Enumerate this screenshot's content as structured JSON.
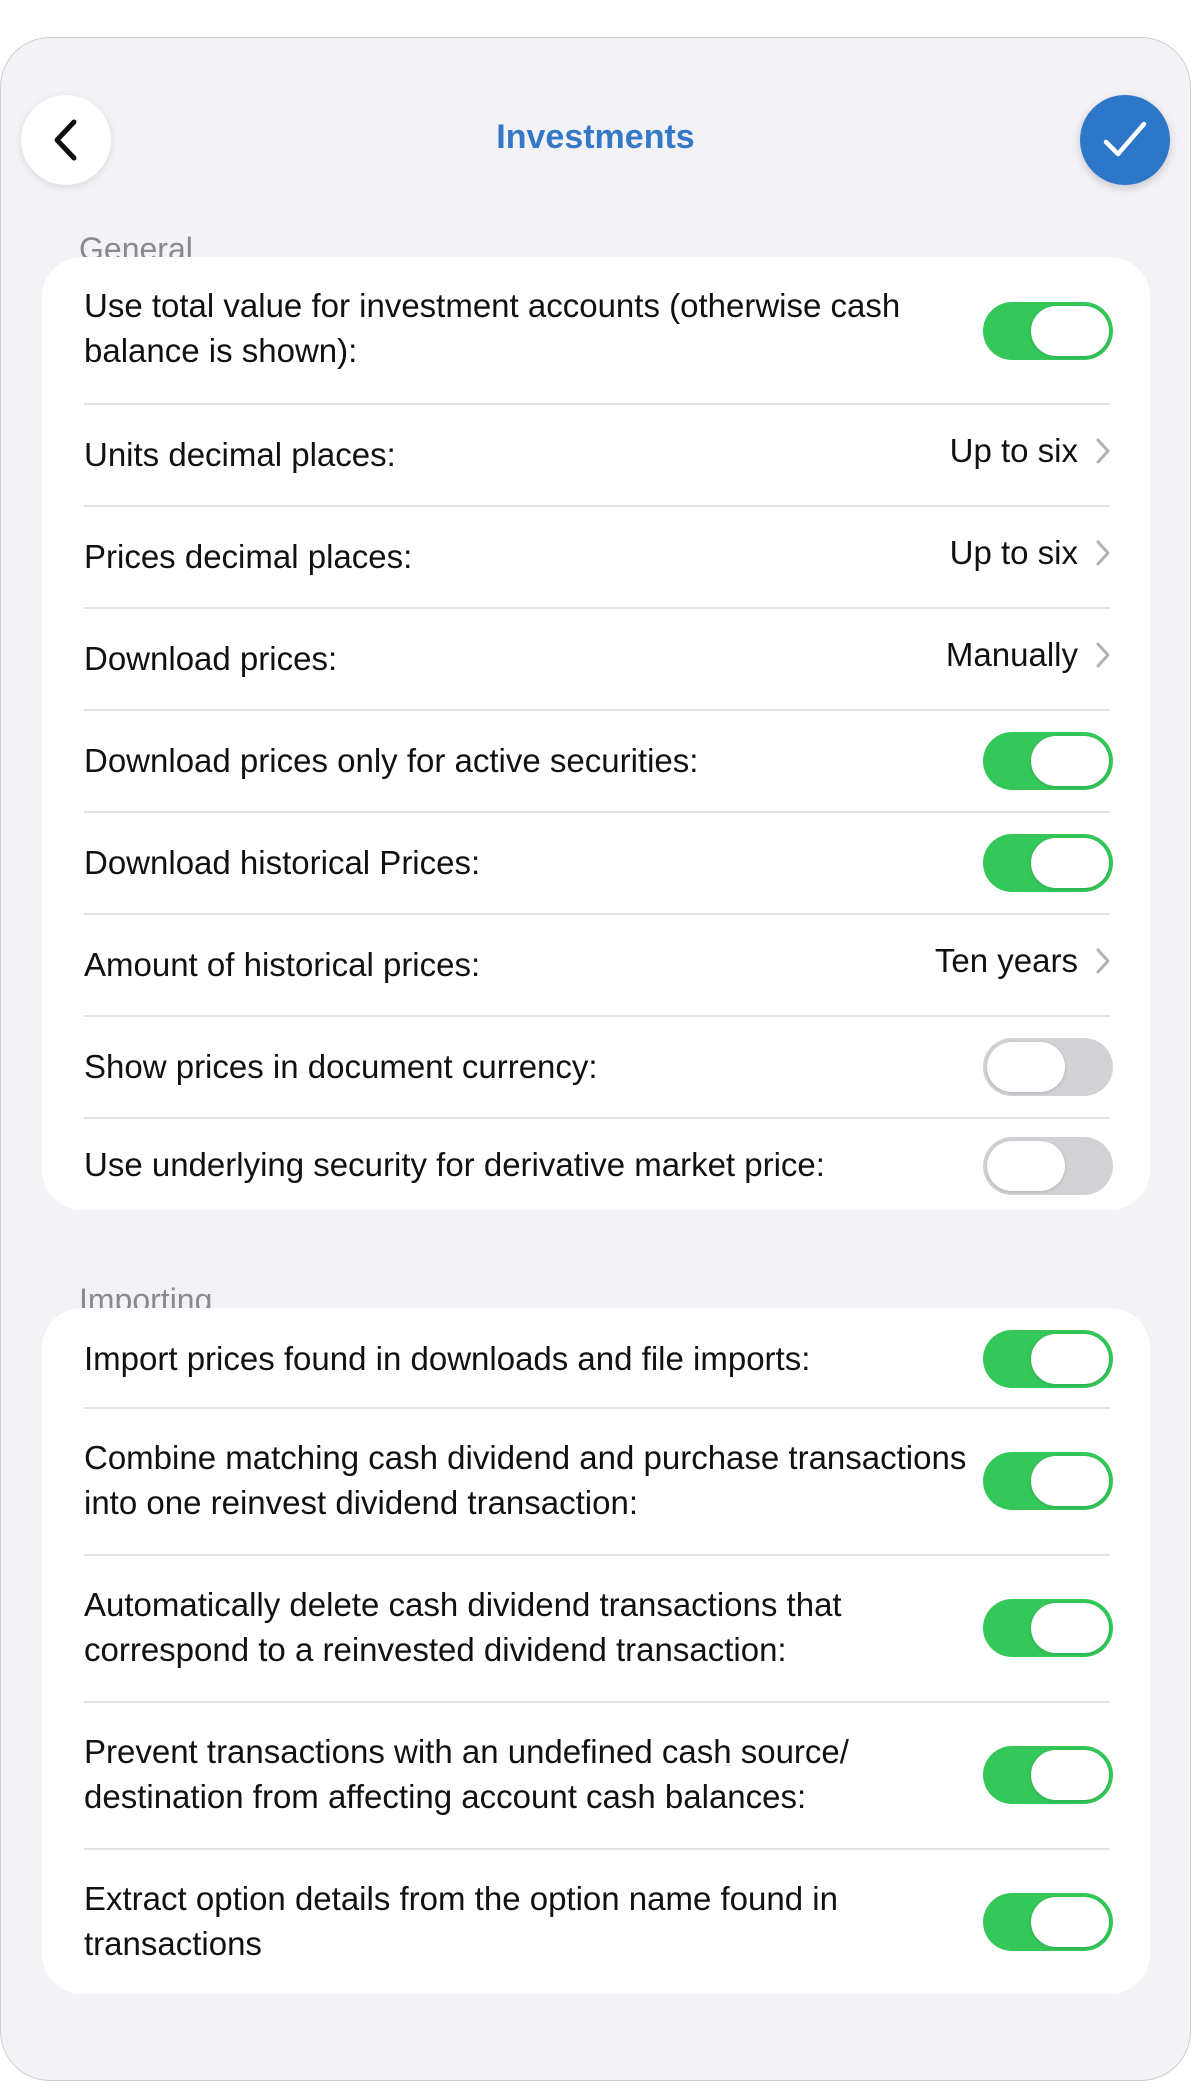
{
  "header": {
    "title": "Investments",
    "back_icon": "chevron-left-icon",
    "done_icon": "checkmark-icon",
    "accent_color": "#2d77c9"
  },
  "sections": {
    "general": {
      "title": "General",
      "rows": [
        {
          "label": "Use total value for investment accounts (otherwise cash balance is shown):",
          "type": "toggle",
          "on": true
        },
        {
          "label": "Units decimal places:",
          "type": "value",
          "value": "Up to six"
        },
        {
          "label": "Prices decimal places:",
          "type": "value",
          "value": "Up to six"
        },
        {
          "label": "Download prices:",
          "type": "value",
          "value": "Manually"
        },
        {
          "label": "Download prices only for active securities:",
          "type": "toggle",
          "on": true
        },
        {
          "label": "Download historical Prices:",
          "type": "toggle",
          "on": true
        },
        {
          "label": "Amount of historical prices:",
          "type": "value",
          "value": "Ten years"
        },
        {
          "label": "Show prices in document currency:",
          "type": "toggle",
          "on": false
        },
        {
          "label": "Use underlying security for derivative market price:",
          "type": "toggle",
          "on": false
        }
      ]
    },
    "importing": {
      "title": "Importing",
      "rows": [
        {
          "label": "Import prices found in downloads and file imports:",
          "type": "toggle",
          "on": true
        },
        {
          "label": "Combine matching cash dividend and purchase transactions into one reinvest dividend transaction:",
          "type": "toggle",
          "on": true
        },
        {
          "label": "Automatically delete cash dividend transactions that correspond to a reinvested dividend transaction:",
          "type": "toggle",
          "on": true
        },
        {
          "label": "Prevent transactions with an undefined cash source/ destination from affecting account cash balances:",
          "type": "toggle",
          "on": true
        },
        {
          "label": "Extract option details from the option name found in transactions",
          "type": "toggle",
          "on": true
        }
      ]
    }
  },
  "colors": {
    "toggle_on": "#34c759",
    "toggle_off": "#d1d1d6",
    "background": "#f2f2f7"
  }
}
